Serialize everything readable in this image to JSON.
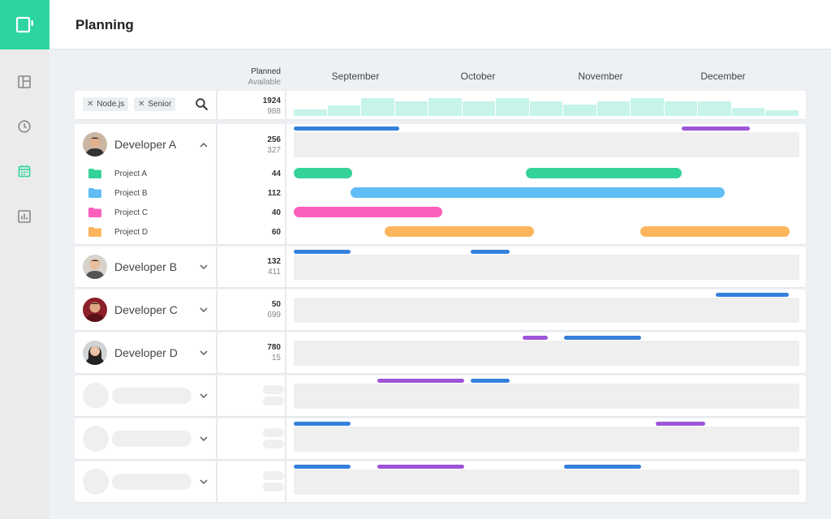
{
  "header": {
    "title": "Planning"
  },
  "columns": {
    "planned": "Planned",
    "available": "Available"
  },
  "months": [
    "September",
    "October",
    "November",
    "December"
  ],
  "filters": [
    {
      "label": "Node.js"
    },
    {
      "label": "Senior"
    }
  ],
  "totals": {
    "planned": "1924",
    "available": "988"
  },
  "capacity_histogram": [
    0.35,
    0.55,
    0.95,
    0.8,
    0.95,
    0.8,
    0.95,
    0.8,
    0.6,
    0.8,
    0.95,
    0.8,
    0.8,
    0.45,
    0.3
  ],
  "developers": [
    {
      "name": "Developer A",
      "planned": "256",
      "available": "327",
      "expanded": true
    },
    {
      "name": "Developer B",
      "planned": "132",
      "available": "411",
      "expanded": false
    },
    {
      "name": "Developer C",
      "planned": "50",
      "available": "699",
      "expanded": false
    },
    {
      "name": "Developer D",
      "planned": "780",
      "available": "15",
      "expanded": false
    }
  ],
  "projects": [
    {
      "name": "Project A",
      "hours": "44",
      "color": "#34d399"
    },
    {
      "name": "Project B",
      "hours": "112",
      "color": "#60bdf5"
    },
    {
      "name": "Project C",
      "hours": "40",
      "color": "#fb5fbd"
    },
    {
      "name": "Project D",
      "hours": "60",
      "color": "#fdb55d"
    }
  ],
  "colors": {
    "accent": "#2dd4a0",
    "assignment_blue": "#3480dc",
    "assignment_purple": "#9d55d8",
    "histogram": "#c6f4ea"
  },
  "icons": {
    "logo": "cup-icon",
    "nav": [
      "dashboard-icon",
      "clock-icon",
      "calendar-icon",
      "chart-icon"
    ],
    "search": "search-icon"
  }
}
